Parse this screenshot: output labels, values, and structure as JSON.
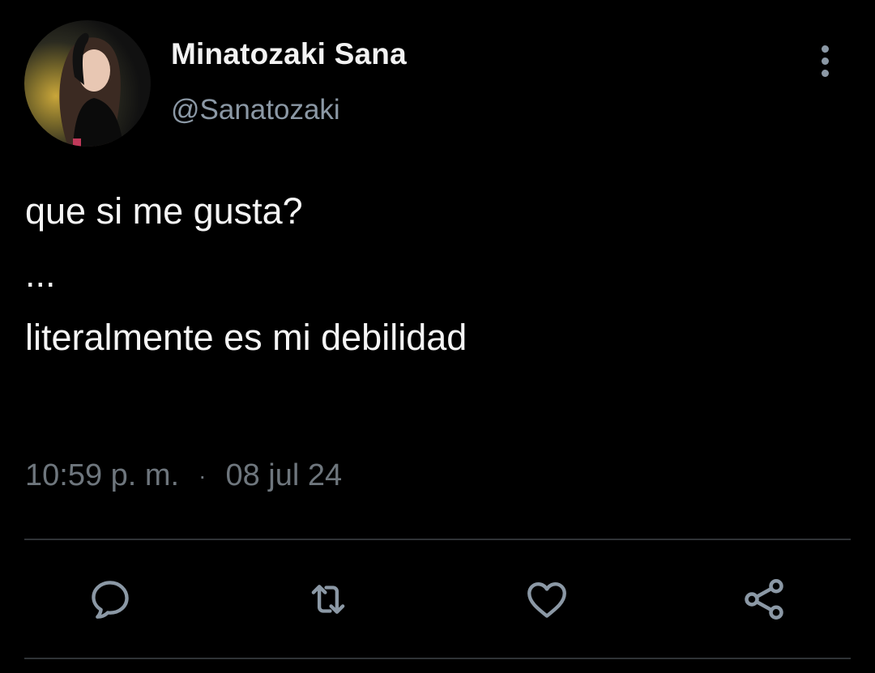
{
  "author": {
    "display_name": "Minatozaki Sana",
    "handle": "@Sanatozaki",
    "avatar_icon": "profile-photo"
  },
  "tweet": {
    "lines": [
      "que si me gusta?",
      "...",
      "literalmente es mi debilidad"
    ],
    "time": "10:59 p. m.",
    "separator": "·",
    "date": "08 jul 24"
  },
  "actions": {
    "reply_icon": "reply-icon",
    "retweet_icon": "retweet-icon",
    "like_icon": "heart-icon",
    "share_icon": "share-icon",
    "more_icon": "more-vertical-icon"
  },
  "colors": {
    "background": "#000000",
    "primary_text": "#f5f5f5",
    "secondary_text": "#8b98a5",
    "icon": "#8b98a5",
    "divider": "#2f3336"
  }
}
